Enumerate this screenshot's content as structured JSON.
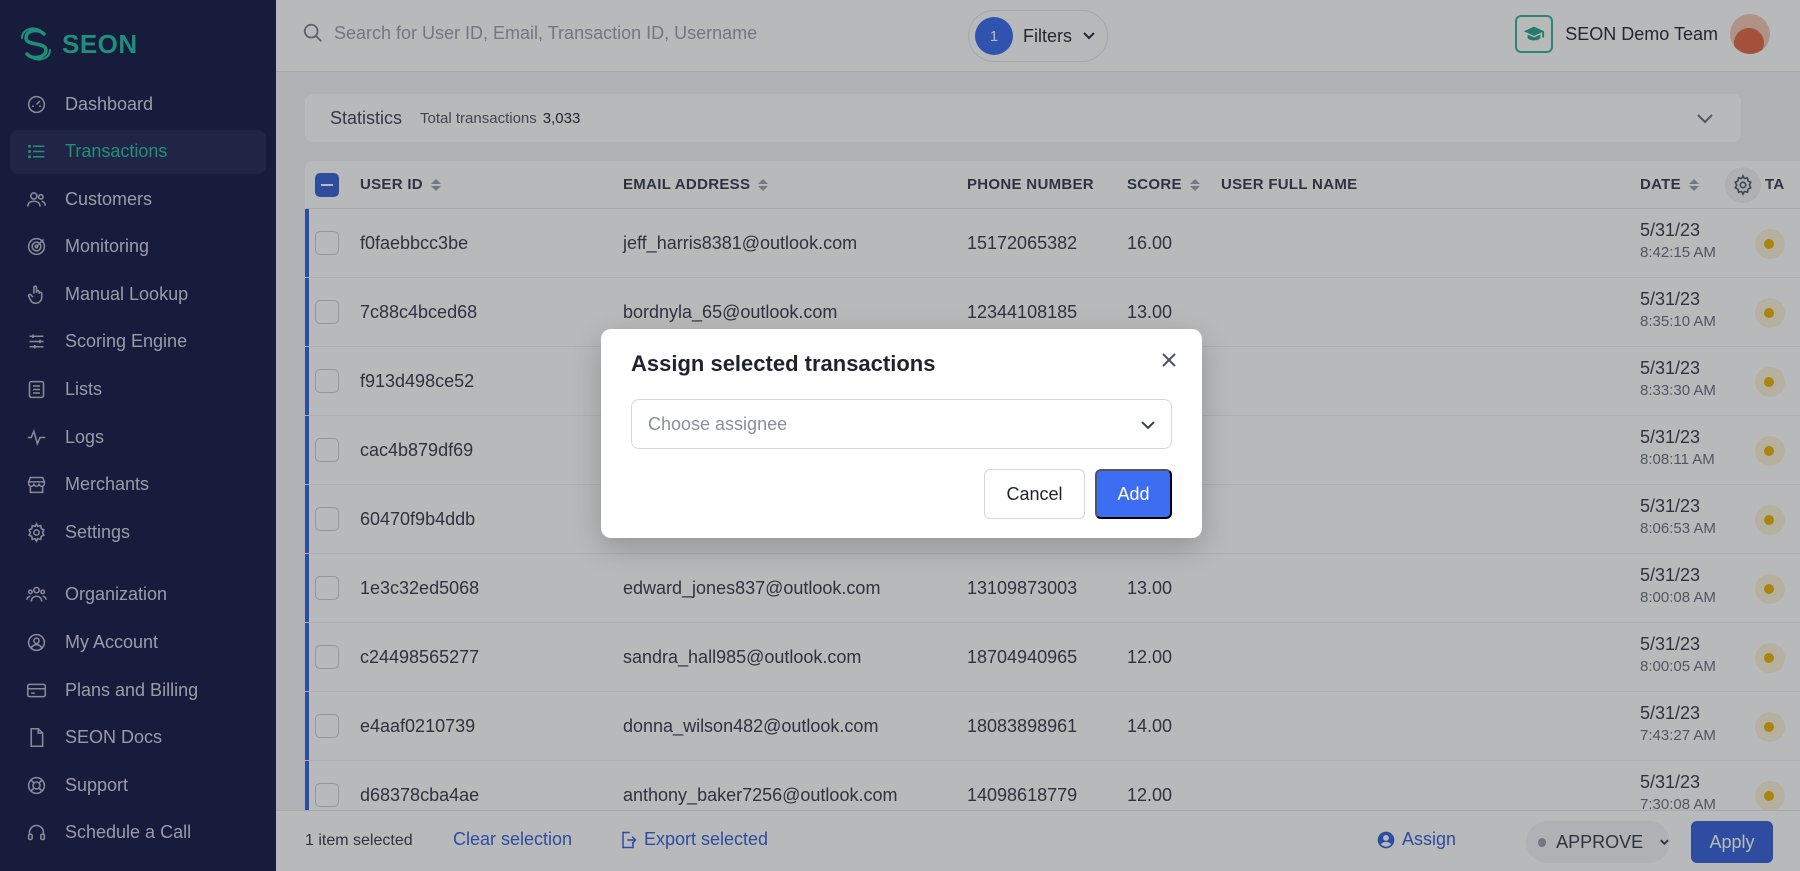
{
  "app": {
    "brand": "SEON"
  },
  "sidebar": {
    "items": [
      {
        "label": "Dashboard",
        "icon": "dashboard-icon"
      },
      {
        "label": "Transactions",
        "icon": "list-icon",
        "active": true
      },
      {
        "label": "Customers",
        "icon": "users-icon"
      },
      {
        "label": "Monitoring",
        "icon": "target-icon"
      },
      {
        "label": "Manual Lookup",
        "icon": "pointer-icon"
      },
      {
        "label": "Scoring Engine",
        "icon": "sliders-icon"
      },
      {
        "label": "Lists",
        "icon": "list-box-icon"
      },
      {
        "label": "Logs",
        "icon": "activity-icon"
      },
      {
        "label": "Merchants",
        "icon": "store-icon"
      },
      {
        "label": "Settings",
        "icon": "gear-icon"
      }
    ],
    "items2": [
      {
        "label": "Organization",
        "icon": "org-icon"
      },
      {
        "label": "My Account",
        "icon": "user-circle-icon"
      },
      {
        "label": "Plans and Billing",
        "icon": "card-icon"
      },
      {
        "label": "SEON Docs",
        "icon": "doc-icon"
      },
      {
        "label": "Support",
        "icon": "lifebuoy-icon"
      },
      {
        "label": "Schedule a Call",
        "icon": "headset-icon"
      }
    ]
  },
  "topbar": {
    "search_placeholder": "Search for User ID, Email, Transaction ID, Username",
    "filters_count": "1",
    "filters_label": "Filters",
    "team_name": "SEON Demo Team"
  },
  "stats": {
    "title": "Statistics",
    "total_label": "Total transactions",
    "total_value": "3,033"
  },
  "table": {
    "columns": {
      "user_id": "USER ID",
      "email": "EMAIL ADDRESS",
      "phone": "PHONE NUMBER",
      "score": "SCORE",
      "full_name": "USER FULL NAME",
      "date": "DATE",
      "extra": "TA"
    },
    "rows": [
      {
        "user_id": "f0faebbcc3be",
        "email": "jeff_harris8381@outlook.com",
        "phone": "15172065382",
        "score": "16.00",
        "date": "5/31/23",
        "time": "8:42:15 AM"
      },
      {
        "user_id": "7c88c4bced68",
        "email": "bordnyla_65@outlook.com",
        "phone": "12344108185",
        "score": "13.00",
        "date": "5/31/23",
        "time": "8:35:10 AM"
      },
      {
        "user_id": "f913d498ce52",
        "email": "",
        "phone": "",
        "score": "",
        "date": "5/31/23",
        "time": "8:33:30 AM"
      },
      {
        "user_id": "cac4b879df69",
        "email": "",
        "phone": "",
        "score": "",
        "date": "5/31/23",
        "time": "8:08:11 AM"
      },
      {
        "user_id": "60470f9b4ddb",
        "email": "",
        "phone": "",
        "score": "",
        "date": "5/31/23",
        "time": "8:06:53 AM"
      },
      {
        "user_id": "1e3c32ed5068",
        "email": "edward_jones837@outlook.com",
        "phone": "13109873003",
        "score": "13.00",
        "date": "5/31/23",
        "time": "8:00:08 AM"
      },
      {
        "user_id": "c24498565277",
        "email": "sandra_hall985@outlook.com",
        "phone": "18704940965",
        "score": "12.00",
        "date": "5/31/23",
        "time": "8:00:05 AM"
      },
      {
        "user_id": "e4aaf0210739",
        "email": "donna_wilson482@outlook.com",
        "phone": "18083898961",
        "score": "14.00",
        "date": "5/31/23",
        "time": "7:43:27 AM"
      },
      {
        "user_id": "d68378cba4ae",
        "email": "anthony_baker7256@outlook.com",
        "phone": "14098618779",
        "score": "12.00",
        "date": "5/31/23",
        "time": "7:30:08 AM"
      }
    ]
  },
  "bottombar": {
    "selected_text": "1 item selected",
    "clear_label": "Clear selection",
    "export_label": "Export selected",
    "assign_label": "Assign",
    "state_value": "APPROVE",
    "apply_label": "Apply"
  },
  "modal": {
    "title": "Assign selected transactions",
    "select_placeholder": "Choose assignee",
    "cancel_label": "Cancel",
    "add_label": "Add"
  },
  "colors": {
    "sidebar_bg": "#1b1f4a",
    "accent_green": "#27c3a4",
    "primary_blue": "#3d6df0"
  }
}
